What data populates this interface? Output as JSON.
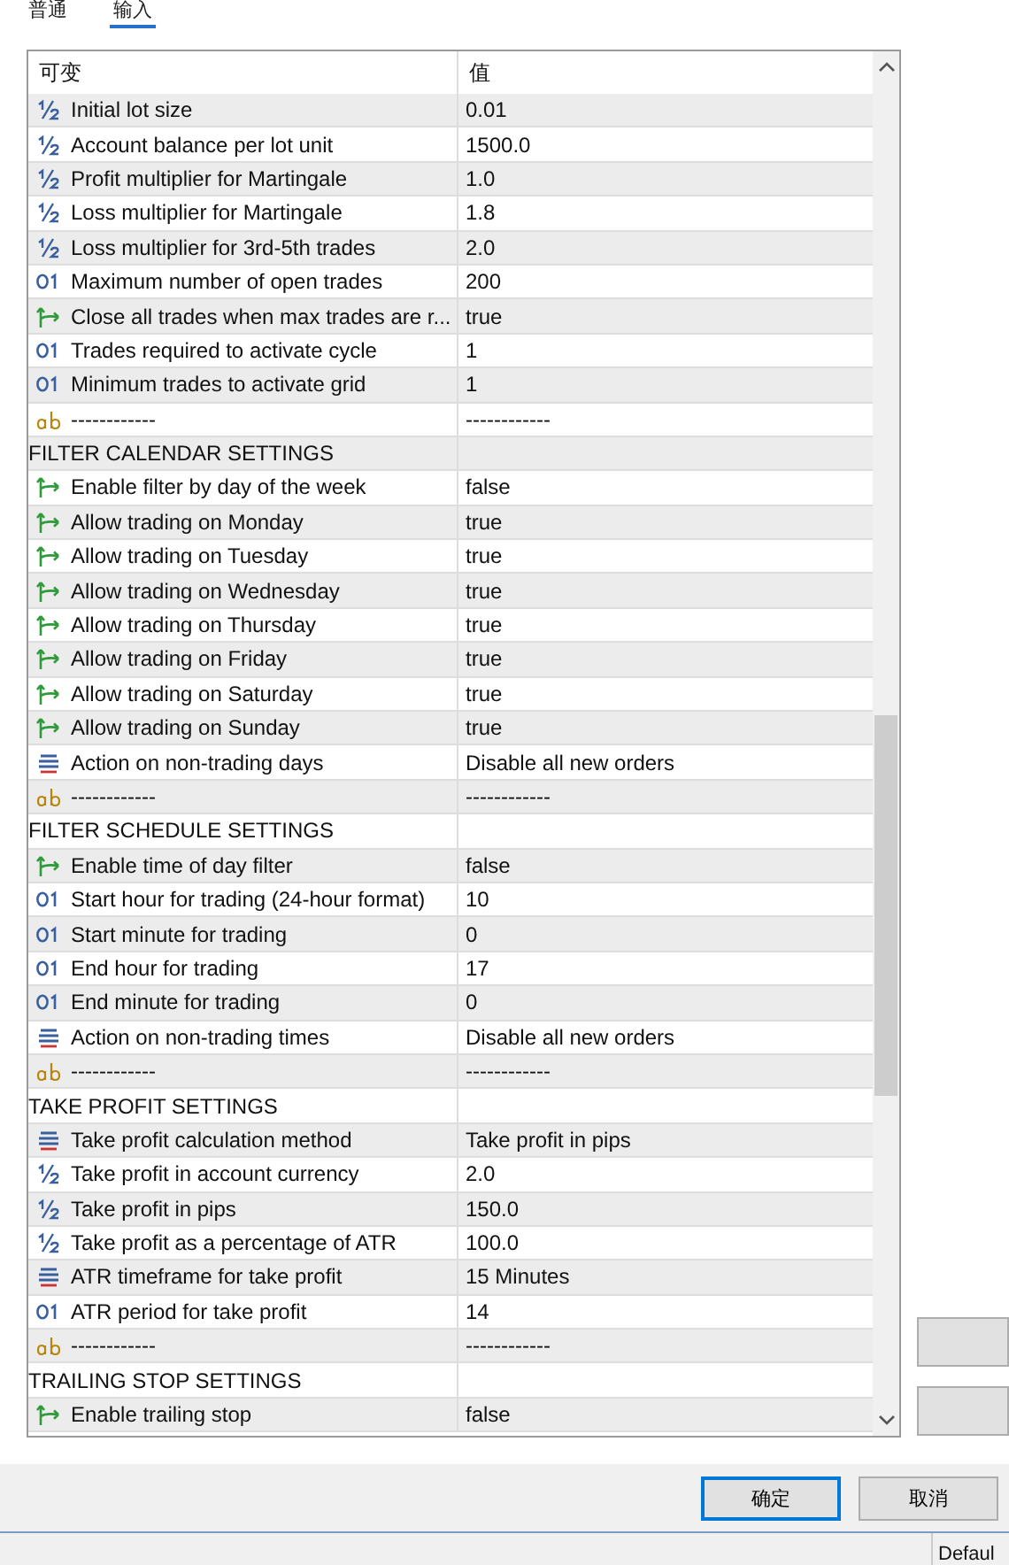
{
  "tabs": [
    {
      "label": "普通",
      "selected": false
    },
    {
      "label": "输入",
      "selected": true
    }
  ],
  "table": {
    "columns": [
      "可变",
      "值"
    ],
    "rows": [
      {
        "kind": "double",
        "name": "Initial lot size",
        "value": "0.01"
      },
      {
        "kind": "double",
        "name": "Account balance per lot unit",
        "value": "1500.0"
      },
      {
        "kind": "double",
        "name": "Profit multiplier for Martingale",
        "value": "1.0"
      },
      {
        "kind": "double",
        "name": "Loss multiplier for Martingale",
        "value": "1.8"
      },
      {
        "kind": "double",
        "name": "Loss multiplier for 3rd-5th trades",
        "value": "2.0"
      },
      {
        "kind": "int",
        "name": "Maximum number of open trades",
        "value": "200"
      },
      {
        "kind": "bool",
        "name": "Close all trades when max trades are r...",
        "value": "true"
      },
      {
        "kind": "int",
        "name": "Trades required to activate cycle",
        "value": "1"
      },
      {
        "kind": "int",
        "name": "Minimum trades to activate grid",
        "value": "1"
      },
      {
        "kind": "string",
        "name": "------------",
        "value": "------------"
      },
      {
        "kind": "section",
        "name": "FILTER CALENDAR SETTINGS"
      },
      {
        "kind": "bool",
        "name": "Enable filter by day of the week",
        "value": "false"
      },
      {
        "kind": "bool",
        "name": "Allow trading on Monday",
        "value": "true"
      },
      {
        "kind": "bool",
        "name": "Allow trading on Tuesday",
        "value": "true"
      },
      {
        "kind": "bool",
        "name": "Allow trading on Wednesday",
        "value": "true"
      },
      {
        "kind": "bool",
        "name": "Allow trading on Thursday",
        "value": "true"
      },
      {
        "kind": "bool",
        "name": "Allow trading on Friday",
        "value": "true"
      },
      {
        "kind": "bool",
        "name": "Allow trading on Saturday",
        "value": "true"
      },
      {
        "kind": "bool",
        "name": "Allow trading on Sunday",
        "value": "true"
      },
      {
        "kind": "enum",
        "name": "Action on non-trading days",
        "value": "Disable all new orders"
      },
      {
        "kind": "string",
        "name": "------------",
        "value": "------------"
      },
      {
        "kind": "section",
        "name": "FILTER SCHEDULE SETTINGS"
      },
      {
        "kind": "bool",
        "name": "Enable time of day filter",
        "value": "false"
      },
      {
        "kind": "int",
        "name": "Start hour for trading (24-hour format)",
        "value": "10"
      },
      {
        "kind": "int",
        "name": "Start minute for trading",
        "value": "0"
      },
      {
        "kind": "int",
        "name": "End hour for trading",
        "value": "17"
      },
      {
        "kind": "int",
        "name": "End minute for trading",
        "value": "0"
      },
      {
        "kind": "enum",
        "name": "Action on non-trading times",
        "value": "Disable all new orders"
      },
      {
        "kind": "string",
        "name": "------------",
        "value": "------------"
      },
      {
        "kind": "section",
        "name": "TAKE PROFIT SETTINGS"
      },
      {
        "kind": "enum",
        "name": "Take profit calculation method",
        "value": "Take profit in pips"
      },
      {
        "kind": "double",
        "name": "Take profit in account currency",
        "value": "2.0"
      },
      {
        "kind": "double",
        "name": "Take profit in pips",
        "value": "150.0"
      },
      {
        "kind": "double",
        "name": "Take profit as a percentage of ATR",
        "value": "100.0"
      },
      {
        "kind": "enum",
        "name": "ATR timeframe for take profit",
        "value": "15 Minutes"
      },
      {
        "kind": "int",
        "name": "ATR period for take profit",
        "value": "14"
      },
      {
        "kind": "string",
        "name": "------------",
        "value": "------------"
      },
      {
        "kind": "section",
        "name": "TRAILING STOP SETTINGS"
      },
      {
        "kind": "bool",
        "name": "Enable trailing stop",
        "value": "false"
      }
    ]
  },
  "buttons": [
    {
      "label": "确定",
      "selected": true
    },
    {
      "label": "取消",
      "selected": false
    }
  ],
  "status_bar": {
    "text": "Defaul"
  }
}
